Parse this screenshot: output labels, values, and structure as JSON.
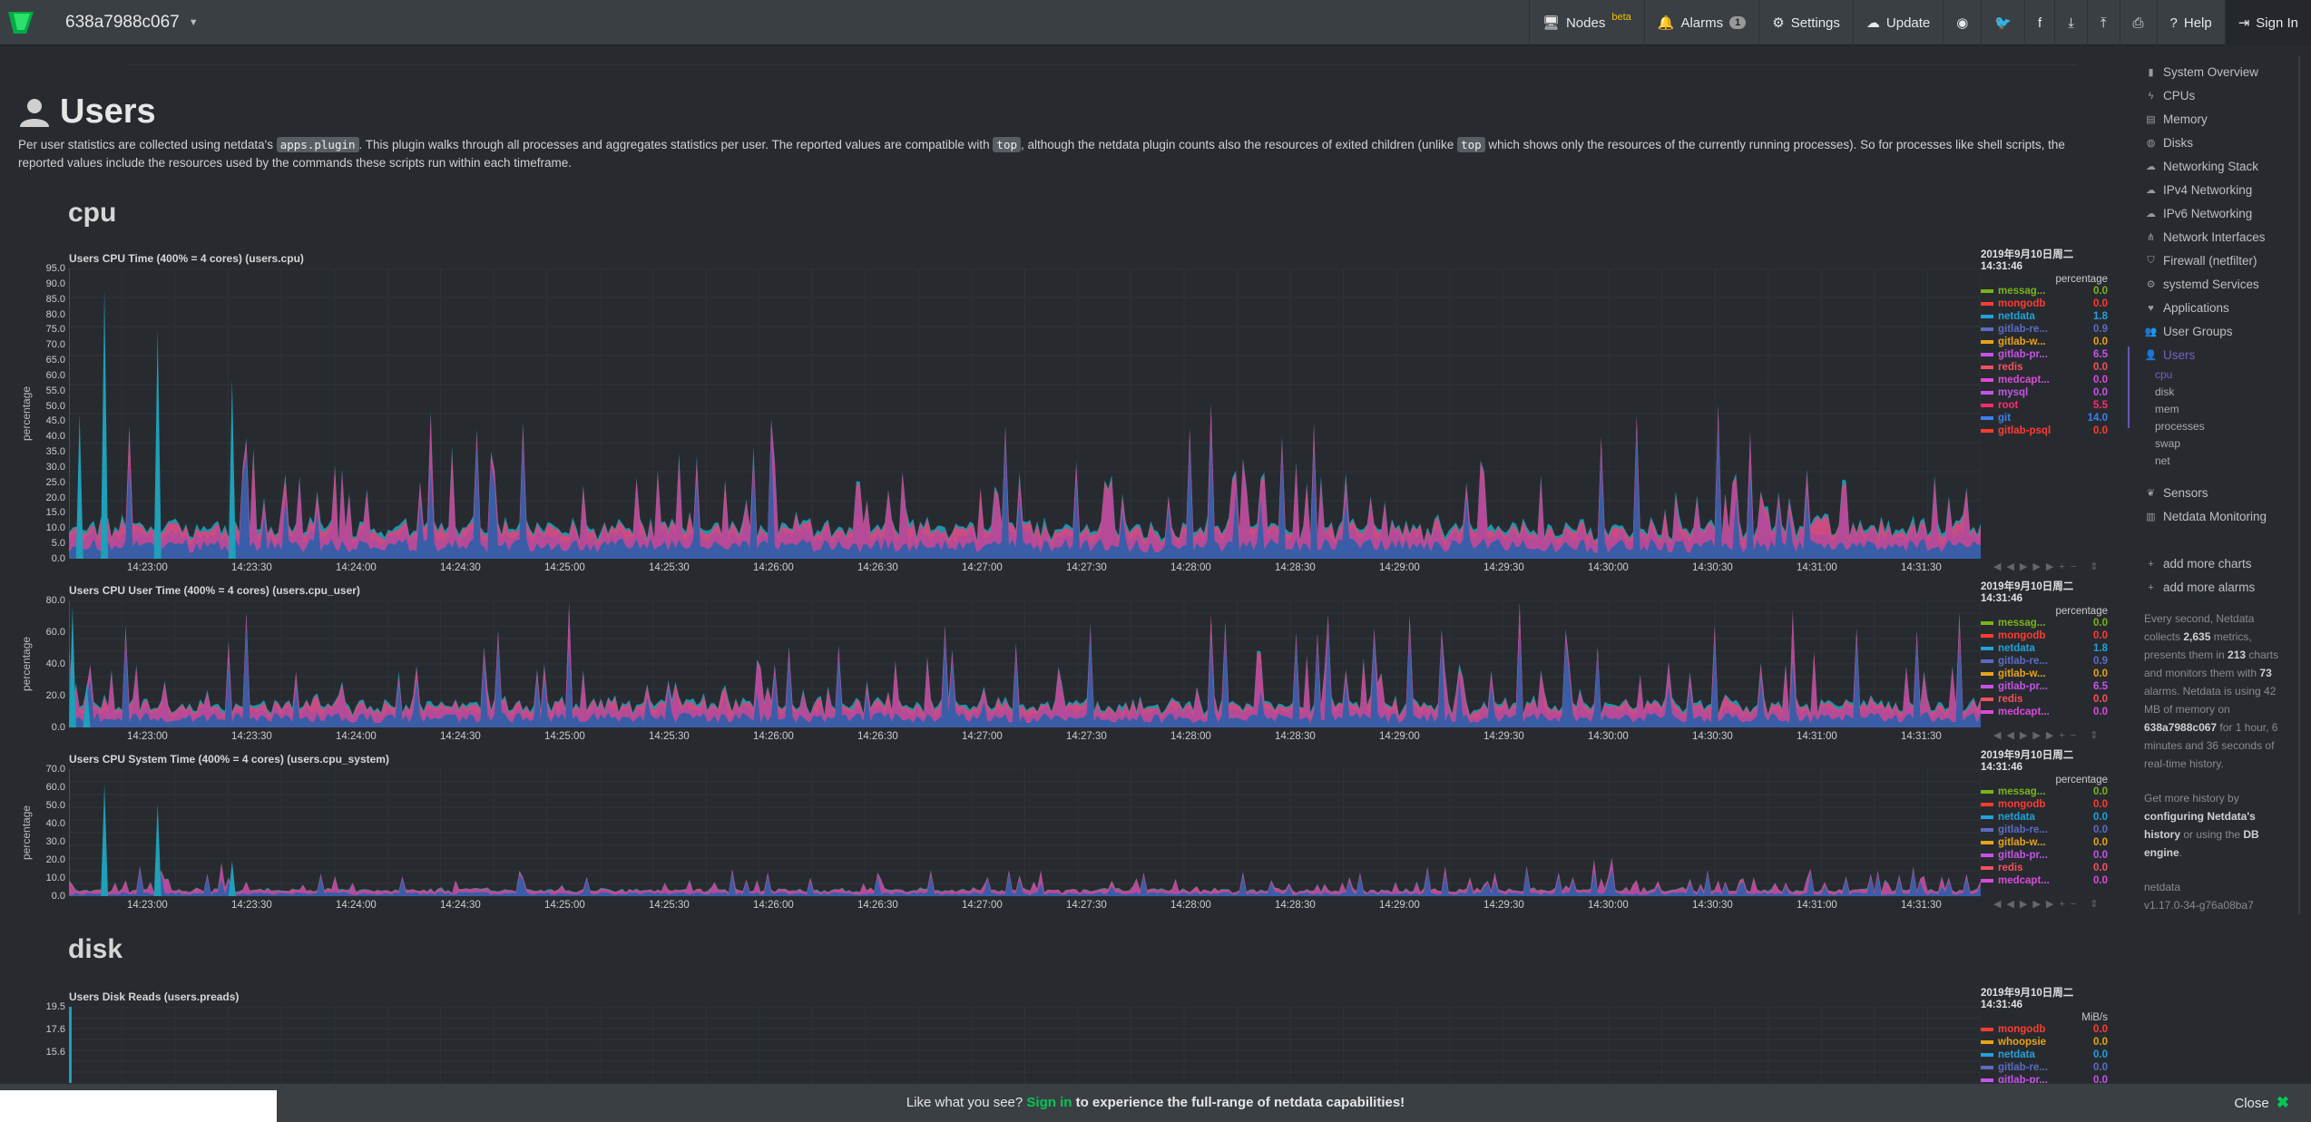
{
  "navbar": {
    "host": "638a7988c067",
    "nodes_label": "Nodes",
    "nodes_badge": "beta",
    "alarms_label": "Alarms",
    "alarms_count": "1",
    "settings_label": "Settings",
    "update_label": "Update",
    "help_label": "Help",
    "signin_label": "Sign In",
    "icon_buttons": [
      "github-icon",
      "twitter-icon",
      "facebook-icon",
      "download-icon",
      "upload-icon",
      "print-icon"
    ]
  },
  "page": {
    "title": "Users",
    "desc_part1": "Per user statistics are collected using netdata's ",
    "desc_code1": "apps.plugin",
    "desc_part2": ". This plugin walks through all processes and aggregates statistics per user. The reported values are compatible with ",
    "desc_code2": "top",
    "desc_part3": ", although the netdata plugin counts also the resources of exited children (unlike ",
    "desc_code3": "top",
    "desc_part4": " which shows only the resources of the currently running processes). So for processes like shell scripts, the reported values include the resources used by the commands these scripts run within each timeframe.",
    "section_cpu": "cpu",
    "section_disk": "disk"
  },
  "x_ticks": [
    "14:23:00",
    "14:23:30",
    "14:24:00",
    "14:24:30",
    "14:25:00",
    "14:25:30",
    "14:26:00",
    "14:26:30",
    "14:27:00",
    "14:27:30",
    "14:28:00",
    "14:28:30",
    "14:29:00",
    "14:29:30",
    "14:30:00",
    "14:30:30",
    "14:31:00",
    "14:31:30"
  ],
  "charts": [
    {
      "title": "Users CPU Time (400% = 4 cores) (users.cpu)",
      "ylabel": "percentage",
      "unit": "percentage",
      "date": "2019年9月10日周二",
      "time": "14:31:46",
      "ymax": 95,
      "yticks": [
        "95.0",
        "90.0",
        "85.0",
        "80.0",
        "75.0",
        "70.0",
        "65.0",
        "60.0",
        "55.0",
        "50.0",
        "45.0",
        "40.0",
        "35.0",
        "30.0",
        "25.0",
        "20.0",
        "15.0",
        "10.0",
        "5.0",
        "0.0"
      ],
      "legend": [
        {
          "name": "messag...",
          "value": "0.0",
          "color": "#7ab317"
        },
        {
          "name": "mongodb",
          "value": "0.0",
          "color": "#ff3b30"
        },
        {
          "name": "netdata",
          "value": "1.8",
          "color": "#23a1db"
        },
        {
          "name": "gitlab-re...",
          "value": "0.9",
          "color": "#5c6bc0"
        },
        {
          "name": "gitlab-w...",
          "value": "0.0",
          "color": "#e8a317"
        },
        {
          "name": "gitlab-pr...",
          "value": "6.5",
          "color": "#c653e8"
        },
        {
          "name": "redis",
          "value": "0.0",
          "color": "#f5505d"
        },
        {
          "name": "medcapt...",
          "value": "0.0",
          "color": "#d94ad9"
        },
        {
          "name": "mysql",
          "value": "0.0",
          "color": "#c653e8"
        },
        {
          "name": "root",
          "value": "5.5",
          "color": "#ff2a6d"
        },
        {
          "name": "git",
          "value": "14.0",
          "color": "#3b7ff0"
        },
        {
          "name": "gitlab-psql",
          "value": "0.0",
          "color": "#ff3b30"
        }
      ]
    },
    {
      "title": "Users CPU User Time (400% = 4 cores) (users.cpu_user)",
      "ylabel": "percentage",
      "unit": "percentage",
      "date": "2019年9月10日周二",
      "time": "14:31:46",
      "ymax": 80,
      "yticks": [
        "80.0",
        "60.0",
        "40.0",
        "20.0",
        "0.0"
      ],
      "legend": [
        {
          "name": "messag...",
          "value": "0.0",
          "color": "#7ab317"
        },
        {
          "name": "mongodb",
          "value": "0.0",
          "color": "#ff3b30"
        },
        {
          "name": "netdata",
          "value": "1.8",
          "color": "#23a1db"
        },
        {
          "name": "gitlab-re...",
          "value": "0.9",
          "color": "#5c6bc0"
        },
        {
          "name": "gitlab-w...",
          "value": "0.0",
          "color": "#e8a317"
        },
        {
          "name": "gitlab-pr...",
          "value": "6.5",
          "color": "#c653e8"
        },
        {
          "name": "redis",
          "value": "0.0",
          "color": "#f5505d"
        },
        {
          "name": "medcapt...",
          "value": "0.0",
          "color": "#d94ad9"
        }
      ]
    },
    {
      "title": "Users CPU System Time (400% = 4 cores) (users.cpu_system)",
      "ylabel": "percentage",
      "unit": "percentage",
      "date": "2019年9月10日周二",
      "time": "14:31:46",
      "ymax": 70,
      "yticks": [
        "70.0",
        "60.0",
        "50.0",
        "40.0",
        "30.0",
        "20.0",
        "10.0",
        "0.0"
      ],
      "legend": [
        {
          "name": "messag...",
          "value": "0.0",
          "color": "#7ab317"
        },
        {
          "name": "mongodb",
          "value": "0.0",
          "color": "#ff3b30"
        },
        {
          "name": "netdata",
          "value": "0.0",
          "color": "#23a1db"
        },
        {
          "name": "gitlab-re...",
          "value": "0.0",
          "color": "#5c6bc0"
        },
        {
          "name": "gitlab-w...",
          "value": "0.0",
          "color": "#e8a317"
        },
        {
          "name": "gitlab-pr...",
          "value": "0.0",
          "color": "#c653e8"
        },
        {
          "name": "redis",
          "value": "0.0",
          "color": "#f5505d"
        },
        {
          "name": "medcapt...",
          "value": "0.0",
          "color": "#d94ad9"
        }
      ]
    },
    {
      "title": "Users Disk Reads (users.preads)",
      "ylabel": "",
      "unit": "MiB/s",
      "date": "2019年9月10日周二",
      "time": "14:31:46",
      "ymax": 19.5,
      "yticks": [
        "19.5",
        "17.6",
        "15.6"
      ],
      "legend": [
        {
          "name": "mongodb",
          "value": "0.0",
          "color": "#ff3b30"
        },
        {
          "name": "whoopsie",
          "value": "0.0",
          "color": "#e8a317"
        },
        {
          "name": "netdata",
          "value": "0.0",
          "color": "#23a1db"
        },
        {
          "name": "gitlab-re...",
          "value": "0.0",
          "color": "#5c6bc0"
        },
        {
          "name": "gitlab-pr...",
          "value": "0.0",
          "color": "#c653e8"
        }
      ]
    }
  ],
  "sidebar": {
    "items": [
      {
        "label": "System Overview",
        "icon": "bookmark-icon"
      },
      {
        "label": "CPUs",
        "icon": "bolt-icon"
      },
      {
        "label": "Memory",
        "icon": "memory-icon"
      },
      {
        "label": "Disks",
        "icon": "disk-icon"
      },
      {
        "label": "Networking Stack",
        "icon": "cloud-icon"
      },
      {
        "label": "IPv4 Networking",
        "icon": "cloud-icon"
      },
      {
        "label": "IPv6 Networking",
        "icon": "cloud-icon"
      },
      {
        "label": "Network Interfaces",
        "icon": "sitemap-icon"
      },
      {
        "label": "Firewall (netfilter)",
        "icon": "shield-icon"
      },
      {
        "label": "systemd Services",
        "icon": "cogs-icon"
      },
      {
        "label": "Applications",
        "icon": "heartbeat-icon"
      },
      {
        "label": "User Groups",
        "icon": "users-icon"
      },
      {
        "label": "Users",
        "icon": "user-icon"
      }
    ],
    "subitems": [
      "cpu",
      "disk",
      "mem",
      "processes",
      "swap",
      "net"
    ],
    "items2": [
      {
        "label": "Sensors",
        "icon": "leaf-icon"
      },
      {
        "label": "Netdata Monitoring",
        "icon": "chart-icon"
      }
    ],
    "add_charts": "add more charts",
    "add_alarms": "add more alarms",
    "info_1": "Every second, Netdata collects ",
    "info_metrics": "2,635",
    "info_2": " metrics, presents them in ",
    "info_charts": "213",
    "info_3": " charts and monitors them with ",
    "info_alarms": "73",
    "info_4": " alarms. Netdata is using 42 MB of memory on ",
    "info_host": "638a7988c067",
    "info_5": " for 1 hour, 6 minutes and 36 seconds of real-time history.",
    "history_1": "Get more history by ",
    "history_link": "configuring Netdata's history",
    "history_2": " or using the ",
    "history_db": "DB engine",
    "history_3": ".",
    "version_name": "netdata",
    "version": "v1.17.0-34-g76a08ba7"
  },
  "banner": {
    "prefix": "Like what you see?",
    "signin": "Sign in",
    "rest": "to experience the full-range of netdata capabilities!",
    "close": "Close"
  }
}
